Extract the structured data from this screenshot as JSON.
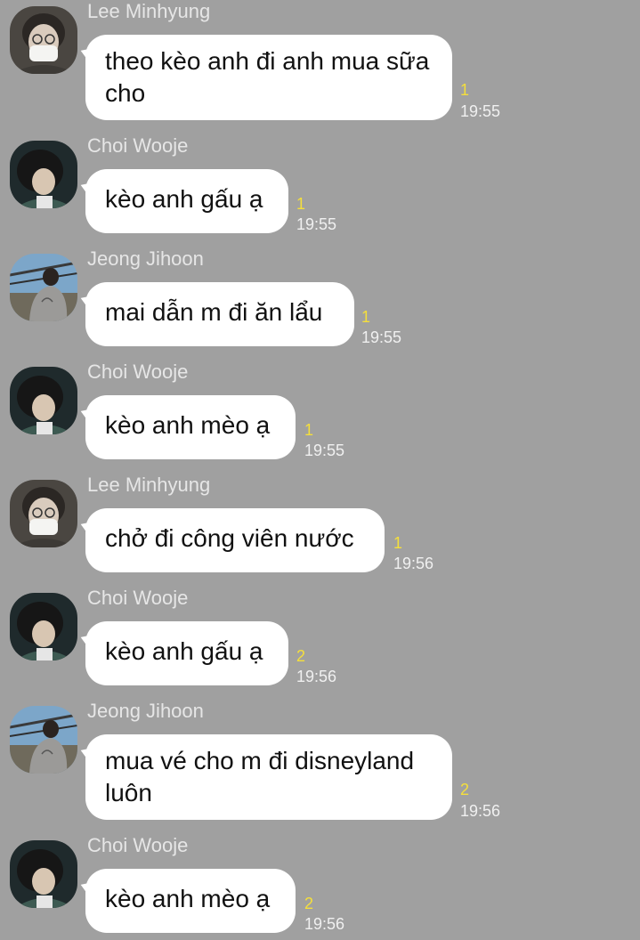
{
  "messages": [
    {
      "sender": "Lee Minhyung",
      "avatar_icon": "avatar-lee-minhyung",
      "text": "theo kèo anh đi anh mua sữa cho",
      "unread": "1",
      "time": "19:55"
    },
    {
      "sender": "Choi Wooje",
      "avatar_icon": "avatar-choi-wooje",
      "text": "kèo anh gấu ạ",
      "unread": "1",
      "time": "19:55"
    },
    {
      "sender": "Jeong Jihoon",
      "avatar_icon": "avatar-jeong-jihoon",
      "text": "mai dẫn m đi ăn lẩu",
      "unread": "1",
      "time": "19:55"
    },
    {
      "sender": "Choi Wooje",
      "avatar_icon": "avatar-choi-wooje",
      "text": "kèo anh mèo ạ",
      "unread": "1",
      "time": "19:55"
    },
    {
      "sender": "Lee Minhyung",
      "avatar_icon": "avatar-lee-minhyung",
      "text": "chở đi công viên nước",
      "unread": "1",
      "time": "19:56"
    },
    {
      "sender": "Choi Wooje",
      "avatar_icon": "avatar-choi-wooje",
      "text": "kèo anh gấu ạ",
      "unread": "2",
      "time": "19:56"
    },
    {
      "sender": "Jeong Jihoon",
      "avatar_icon": "avatar-jeong-jihoon",
      "text": "mua vé cho m đi disneyland luôn",
      "unread": "2",
      "time": "19:56"
    },
    {
      "sender": "Choi Wooje",
      "avatar_icon": "avatar-choi-wooje",
      "text": "kèo anh mèo ạ",
      "unread": "2",
      "time": "19:56"
    }
  ],
  "colors": {
    "background": "#a0a0a0",
    "bubble": "#ffffff",
    "sender_name": "#e6e6e6",
    "unread_count": "#f5df3b",
    "timestamp": "#f0f0f0"
  }
}
